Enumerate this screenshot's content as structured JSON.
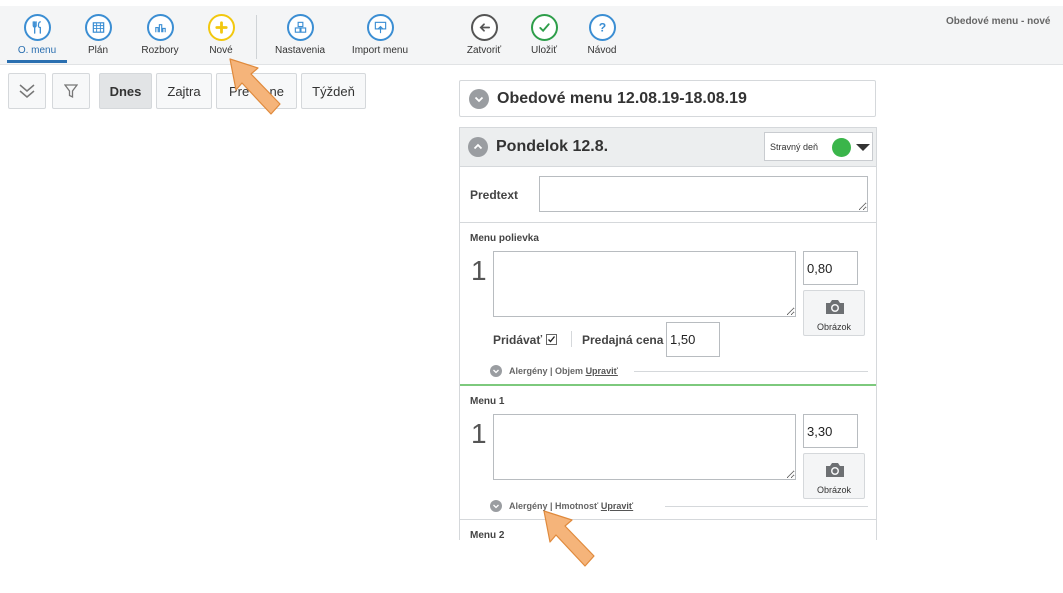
{
  "window_title": "Obedové menu - nové",
  "toolbar": {
    "items": [
      {
        "label": "O. menu",
        "icon": "fork-knife-icon",
        "active": true
      },
      {
        "label": "Plán",
        "icon": "calendar-grid-icon"
      },
      {
        "label": "Rozbory",
        "icon": "bar-chart-icon"
      },
      {
        "label": "Nové",
        "icon": "plus-icon",
        "accent": "#f2c80f"
      },
      {
        "label": "Nastavenia",
        "icon": "boxes-icon"
      },
      {
        "label": "Import menu",
        "icon": "import-icon"
      },
      {
        "label": "Zatvoriť",
        "icon": "back-arrow-icon",
        "accent": "#555555"
      },
      {
        "label": "Uložiť",
        "icon": "check-icon",
        "accent": "#2e9e4a"
      },
      {
        "label": "Návod",
        "icon": "question-icon"
      }
    ]
  },
  "filters": {
    "expand_icon": "double-chevron-down-icon",
    "filter_icon": "funnel-icon",
    "days": [
      "Dnes",
      "Zajtra",
      "Pre",
      "ne",
      "Týždeň"
    ]
  },
  "menu_header": {
    "title": "Obedové menu 12.08.19-18.08.19"
  },
  "day": {
    "title": "Pondelok 12.8.",
    "status_label": "Stravný deň",
    "status_color": "#3ab54a",
    "predtext_label": "Predtext",
    "sections": [
      {
        "title": "Menu polievka",
        "number": "1",
        "price": "0,80",
        "image_label": "Obrázok",
        "add_label": "Pridávať",
        "sale_price_label": "Predajná cena",
        "sale_price": "1,50",
        "allergen_text": "Alergény | Objem",
        "edit_label": "Upraviť"
      },
      {
        "title": "Menu 1",
        "number": "1",
        "price": "3,30",
        "image_label": "Obrázok",
        "allergen_text": "Alergény | Hmotnosť",
        "edit_label": "Upraviť"
      },
      {
        "title": "Menu 2"
      }
    ]
  },
  "colors": {
    "primary_blue": "#3b8ed3",
    "active_underline": "#2a6fb0",
    "soup_divider": "#7dc97d",
    "annotation_arrow": "#f5b47a"
  }
}
